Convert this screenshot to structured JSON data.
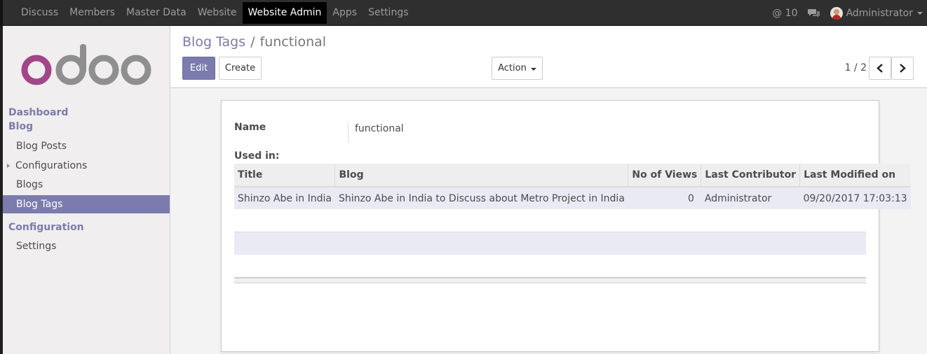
{
  "navbar": {
    "menu": [
      {
        "label": "Discuss"
      },
      {
        "label": "Members"
      },
      {
        "label": "Master Data"
      },
      {
        "label": "Website"
      },
      {
        "label": "Website Admin",
        "active": true
      },
      {
        "label": "Apps"
      },
      {
        "label": "Settings"
      }
    ],
    "mentions_count": "@ 10",
    "chat_icon": "chat-bubbles-icon",
    "user_name": "Administrator"
  },
  "sidebar": {
    "logo_text": "odoo",
    "section_dashboard": "Dashboard",
    "section_blog": "Blog",
    "blog_items": [
      "Blog Posts",
      "Configurations",
      "Blogs",
      "Blog Tags"
    ],
    "section_configuration": "Configuration",
    "configuration_items": [
      "Settings"
    ],
    "active_item": "Blog Tags"
  },
  "control_panel": {
    "breadcrumb_parent": "Blog Tags",
    "breadcrumb_separator": "/",
    "breadcrumb_current": "functional",
    "edit_label": "Edit",
    "create_label": "Create",
    "action_label": "Action",
    "pager": "1 / 2"
  },
  "form": {
    "name_label": "Name",
    "name_value": "functional",
    "used_in_label": "Used in:",
    "columns": [
      "Title",
      "Blog",
      "No of Views",
      "Last Contributor",
      "Last Modified on"
    ],
    "rows": [
      {
        "title": "Shinzo Abe in India",
        "blog": "Shinzo Abe in India to Discuss about Metro Project in India",
        "views": "0",
        "contributor": "Administrator",
        "modified": "09/20/2017 17:03:13"
      }
    ]
  },
  "colors": {
    "brand": "#7c7bad",
    "navbar_bg": "#2f2f2f",
    "sidebar_bg": "#f0eeee"
  }
}
